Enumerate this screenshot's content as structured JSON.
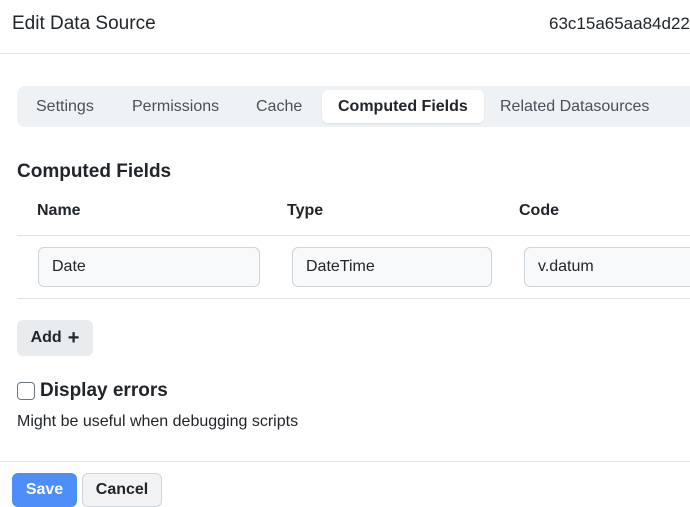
{
  "header": {
    "title": "Edit Data Source",
    "record_id": "63c15a65aa84d22"
  },
  "tabs": [
    {
      "label": "Settings",
      "active": false
    },
    {
      "label": "Permissions",
      "active": false
    },
    {
      "label": "Cache",
      "active": false
    },
    {
      "label": "Computed Fields",
      "active": true
    },
    {
      "label": "Related Datasources",
      "active": false
    }
  ],
  "computed_fields": {
    "title": "Computed Fields",
    "columns": [
      "Name",
      "Type",
      "Code"
    ],
    "rows": [
      {
        "name": "Date",
        "type": "DateTime",
        "code": "v.datum"
      }
    ],
    "add_label": "Add"
  },
  "display_errors": {
    "label": "Display errors",
    "checked": false,
    "help": "Might be useful when debugging scripts"
  },
  "footer": {
    "save_label": "Save",
    "cancel_label": "Cancel"
  },
  "colors": {
    "primary": "#4d8ef8",
    "tab_bar": "#eff2f5",
    "border": "#dee2e6"
  }
}
